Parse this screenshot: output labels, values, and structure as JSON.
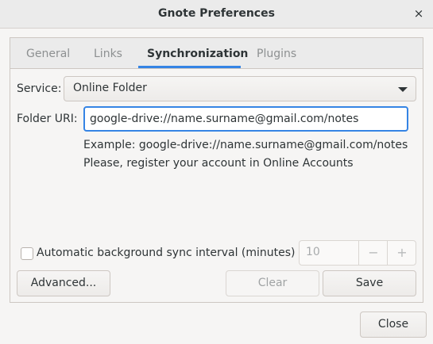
{
  "window": {
    "title": "Gnote Preferences",
    "close_glyph": "×"
  },
  "tabs": [
    {
      "label": "General"
    },
    {
      "label": "Links"
    },
    {
      "label": "Synchronization"
    },
    {
      "label": "Plugins"
    }
  ],
  "sync": {
    "service_label": "Service:",
    "service_value": "Online Folder",
    "folder_label": "Folder URI:",
    "folder_value": "google-drive://name.surname@gmail.com/notes",
    "example_text": "Example: google-drive://name.surname@gmail.com/notes",
    "register_text": "Please, register your account in Online Accounts",
    "auto_sync_label": "Automatic background sync interval (minutes)",
    "interval_value": "10",
    "minus_glyph": "−",
    "plus_glyph": "+"
  },
  "buttons": {
    "advanced": "Advanced...",
    "clear": "Clear",
    "save": "Save",
    "close": "Close"
  },
  "colors": {
    "accent": "#3584e4"
  }
}
